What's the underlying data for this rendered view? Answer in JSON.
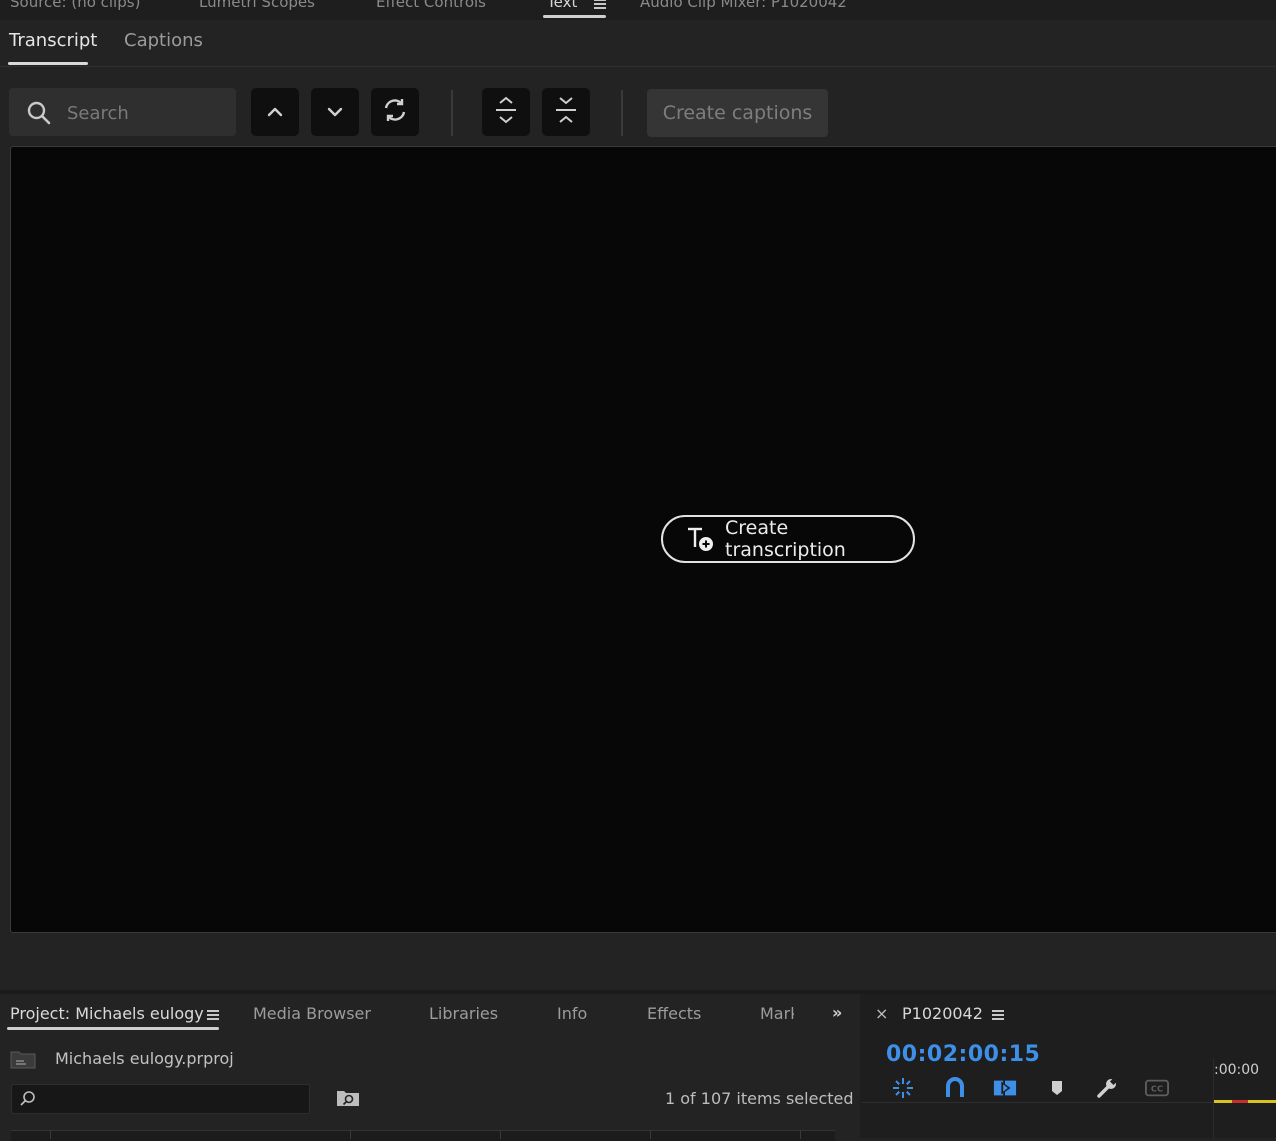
{
  "top_tabs": [
    {
      "label": "Source: (no clips)"
    },
    {
      "label": "Lumetri Scopes"
    },
    {
      "label": "Effect Controls"
    },
    {
      "label": "Text"
    },
    {
      "label": "Audio Clip Mixer: P1020042"
    }
  ],
  "text_panel": {
    "subtabs": [
      {
        "label": "Transcript"
      },
      {
        "label": "Captions"
      }
    ],
    "active_subtab": "Transcript",
    "search": {
      "placeholder": "Search",
      "value": ""
    },
    "toolbar": {
      "prev_icon": "chevron-up-icon",
      "next_icon": "chevron-down-icon",
      "refresh_icon": "refresh-icon",
      "expand_icon": "expand-all-icon",
      "collapse_icon": "collapse-all-icon",
      "create_captions_label": "Create captions"
    },
    "create_transcription_label": "Create transcription"
  },
  "project_panel": {
    "tabs": [
      {
        "label": "Project: Michaels eulogy"
      },
      {
        "label": "Media Browser"
      },
      {
        "label": "Libraries"
      },
      {
        "label": "Info"
      },
      {
        "label": "Effects"
      },
      {
        "label": "Mark"
      }
    ],
    "more_label": "»",
    "project_file": "Michaels eulogy.prproj",
    "search": {
      "placeholder": "",
      "value": ""
    },
    "selection_status": "1 of 107 items selected"
  },
  "sequence_panel": {
    "close_label": "×",
    "sequence_name": "P1020042",
    "timecode": "00:02:00:15",
    "ruler_label": ":00:00",
    "accent_color": "#3d8fe8"
  }
}
